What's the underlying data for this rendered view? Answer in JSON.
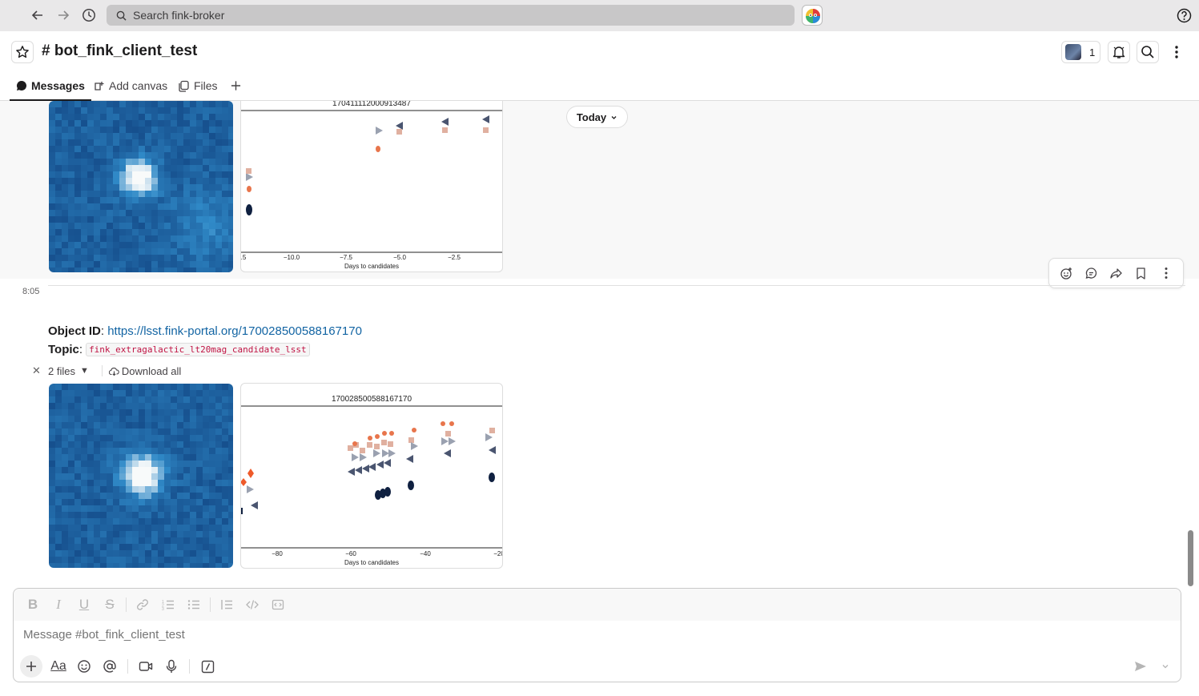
{
  "search": {
    "placeholder": "Search fink-broker"
  },
  "channel": {
    "name": "# bot_fink_client_test",
    "member_count": "1"
  },
  "tabs": [
    {
      "label": "Messages",
      "active": true,
      "icon": "message-bubble-icon"
    },
    {
      "label": "Add canvas",
      "icon": "canvas-icon"
    },
    {
      "label": "Files",
      "icon": "files-icon"
    }
  ],
  "date_divider": {
    "label": "Today"
  },
  "previous_message": {
    "chart": {
      "title": "170411112000913487",
      "xlabel": "Days to candidates",
      "ticks": [
        ".5",
        "−10.0",
        "−7.5",
        "−5.0",
        "−2.5"
      ]
    }
  },
  "message": {
    "time": "8:05",
    "object_label": "Object ID",
    "object_url": "https://lsst.fink-portal.org/170028500588167170",
    "topic_label": "Topic",
    "topic": "fink_extragalactic_lt20mag_candidate_lsst",
    "files_label": "2 files",
    "download_label": "Download all",
    "chart": {
      "title": "170028500588167170",
      "xlabel": "Days to candidates",
      "ticks": [
        "−80",
        "−60",
        "−40",
        "−20"
      ]
    }
  },
  "composer": {
    "placeholder": "Message #bot_fink_client_test"
  },
  "colors": {
    "link": "#1264a3",
    "code": "#c01343",
    "series_r": "#e8754c",
    "series_g": "#e0b0a0",
    "series_upper": "#9aa1b0",
    "series_dark": "#0f2040"
  }
}
